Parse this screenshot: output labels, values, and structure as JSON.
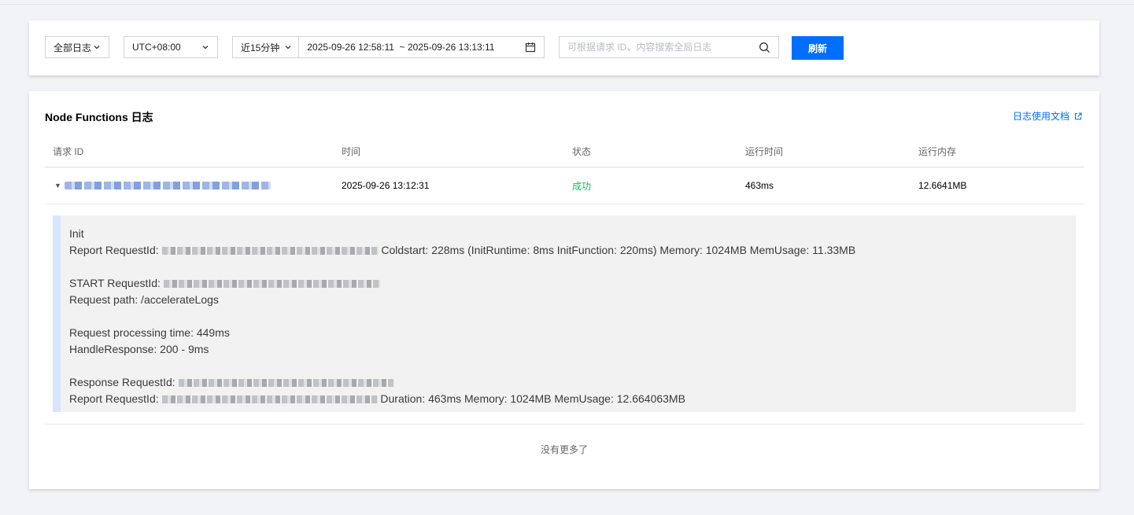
{
  "filters": {
    "log_type": "全部日志",
    "timezone": "UTC+08:00",
    "quick_range": "近15分钟",
    "start_time": "2025-09-26 12:58:11",
    "range_sep": "~",
    "end_time": "2025-09-26 13:13:11",
    "search_placeholder": "可根据请求 ID、内容搜索全局日志",
    "search_value": "",
    "refresh_label": "刷新"
  },
  "log_panel": {
    "title": "Node Functions 日志",
    "doc_link": "日志使用文档",
    "columns": [
      "请求 ID",
      "时间",
      "状态",
      "运行时间",
      "运行内存"
    ],
    "rows": [
      {
        "request_id": "",
        "time": "2025-09-26 13:12:31",
        "status": "成功",
        "duration": "463ms",
        "memory": "12.6641MB"
      }
    ],
    "detail": {
      "l1": "Init",
      "l2_prefix": " Report RequestId:",
      "l2_suffix": "Coldstart: 228ms (InitRuntime: 8ms InitFunction: 220ms) Memory: 1024MB MemUsage: 11.33MB",
      "l3_prefix": "START RequestId:",
      "l4": "Request path: /accelerateLogs",
      "l5": "Request processing time: 449ms",
      "l6": "HandleResponse: 200 - 9ms",
      "l7_prefix": "Response RequestId:",
      "l8_prefix": "Report RequestId:",
      "l8_suffix": "Duration: 463ms Memory: 1024MB MemUsage: 12.664063MB"
    },
    "footer": "没有更多了"
  },
  "colors": {
    "accent": "#006eff",
    "success": "#0abf5b",
    "detail_bar": "#d5e6ff"
  },
  "icons": [
    "chevron-down-icon",
    "calendar-icon",
    "search-icon",
    "external-link-icon",
    "caret-down-icon"
  ]
}
